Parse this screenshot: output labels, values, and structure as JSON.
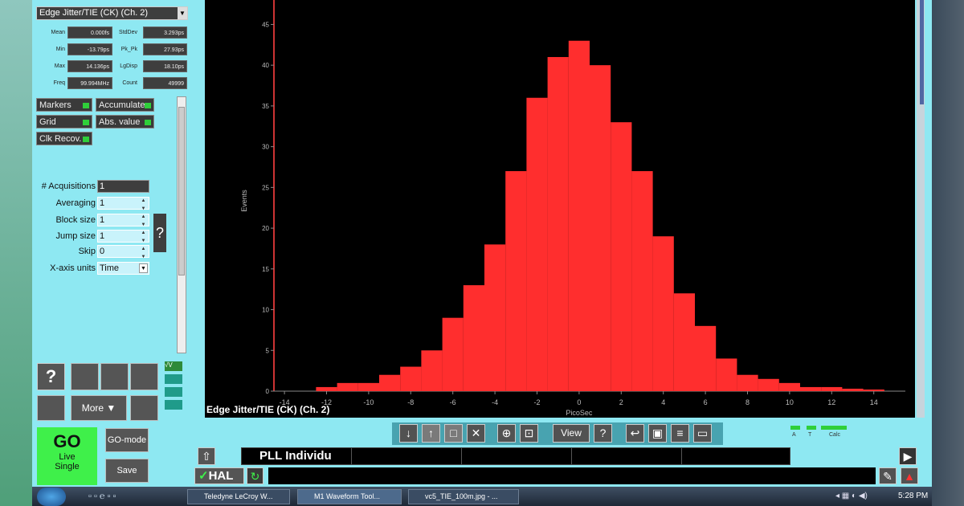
{
  "measure_select": "Edge Jitter/TIE (CK) (Ch. 2)",
  "stats": [
    {
      "label": "Mean",
      "value": "0.000fs"
    },
    {
      "label": "StdDev",
      "value": "3.293ps"
    },
    {
      "label": "Min",
      "value": "-13.79ps"
    },
    {
      "label": "Pk_Pk",
      "value": "27.93ps"
    },
    {
      "label": "Max",
      "value": "14.136ps"
    },
    {
      "label": "LgDisp",
      "value": "18.10ps"
    },
    {
      "label": "Freq",
      "value": "99.994MHz"
    },
    {
      "label": "Count",
      "value": "49999"
    }
  ],
  "toggles": {
    "markers": "Markers",
    "accumulate": "Accumulate",
    "grid": "Grid",
    "abs_value": "Abs. value",
    "clk_recov": "Clk Recov."
  },
  "params": [
    {
      "label": "# Acquisitions",
      "value": "1"
    },
    {
      "label": "Averaging",
      "value": "1"
    },
    {
      "label": "Block size",
      "value": "1"
    },
    {
      "label": "Jump size",
      "value": "1"
    },
    {
      "label": "Skip",
      "value": "0"
    },
    {
      "label": "X-axis units",
      "value": "Time"
    }
  ],
  "help_glyph": "?",
  "buttons": {
    "more": "More",
    "go": "GO",
    "live": "Live",
    "single": "Single",
    "go_mode": "GO-mode",
    "save": "Save",
    "view": "View",
    "hal": "HAL",
    "fv": "√V"
  },
  "plot_caption": "Edge Jitter/TIE (CK) (Ch. 2)",
  "status_leds": [
    "A",
    "T",
    "Calc"
  ],
  "pll_text": "PLL Individu",
  "taskbar": {
    "tasks": [
      "Teledyne LeCroy W...",
      "M1 Waveform Tool...",
      "vc5_TIE_100m.jpg - ..."
    ],
    "time": "5:28 PM"
  },
  "chart_data": {
    "type": "bar",
    "xlabel": "PicoSec",
    "ylabel": "Events",
    "xlim": [
      -14.5,
      15.5
    ],
    "ylim": [
      0,
      48
    ],
    "xticks": [
      -14,
      -12,
      -10,
      -8,
      -6,
      -4,
      -2,
      0,
      2,
      4,
      6,
      8,
      10,
      12,
      14
    ],
    "yticks": [
      0,
      5,
      10,
      15,
      20,
      25,
      30,
      35,
      40,
      45
    ],
    "color": "#ff2e2e",
    "x": [
      -12,
      -11,
      -10,
      -9,
      -8,
      -7,
      -6,
      -5,
      -4,
      -3,
      -2,
      -1,
      0,
      1,
      2,
      3,
      4,
      5,
      6,
      7,
      8,
      9,
      10,
      11,
      12,
      13,
      14
    ],
    "values": [
      0.5,
      1,
      1,
      2,
      3,
      5,
      9,
      13,
      18,
      27,
      36,
      41,
      43,
      40,
      33,
      27,
      19,
      12,
      8,
      4,
      2,
      1.5,
      1,
      0.5,
      0.5,
      0.3,
      0.2
    ]
  }
}
